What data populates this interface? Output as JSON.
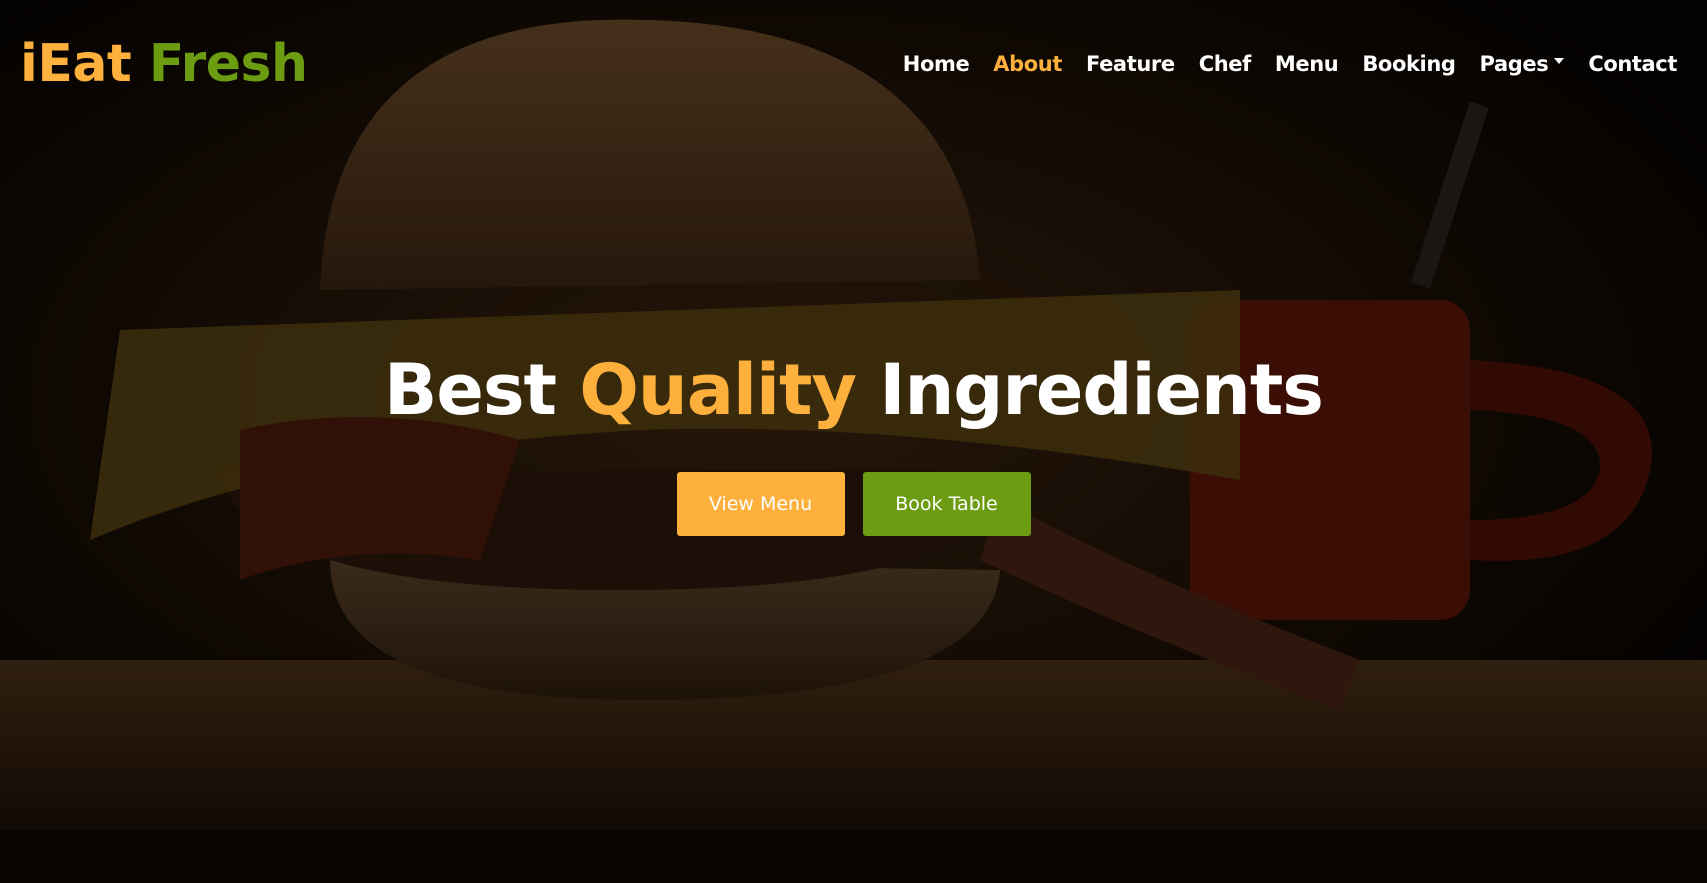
{
  "brand": {
    "part1": "iEat",
    "part2": "Fresh"
  },
  "nav": {
    "items": [
      {
        "label": "Home",
        "active": false
      },
      {
        "label": "About",
        "active": true
      },
      {
        "label": "Feature",
        "active": false
      },
      {
        "label": "Chef",
        "active": false
      },
      {
        "label": "Menu",
        "active": false
      },
      {
        "label": "Booking",
        "active": false
      },
      {
        "label": "Pages",
        "active": false,
        "dropdown": true
      },
      {
        "label": "Contact",
        "active": false
      }
    ]
  },
  "hero": {
    "headline_part1": "Best",
    "headline_accent": "Quality",
    "headline_part2": "Ingredients",
    "view_menu_label": "View Menu",
    "book_table_label": "Book Table"
  },
  "colors": {
    "accent_orange": "#fdb03c",
    "accent_green": "#6b9c12",
    "text_white": "#ffffff"
  },
  "icons": {
    "dropdown": "caret-down-icon"
  }
}
